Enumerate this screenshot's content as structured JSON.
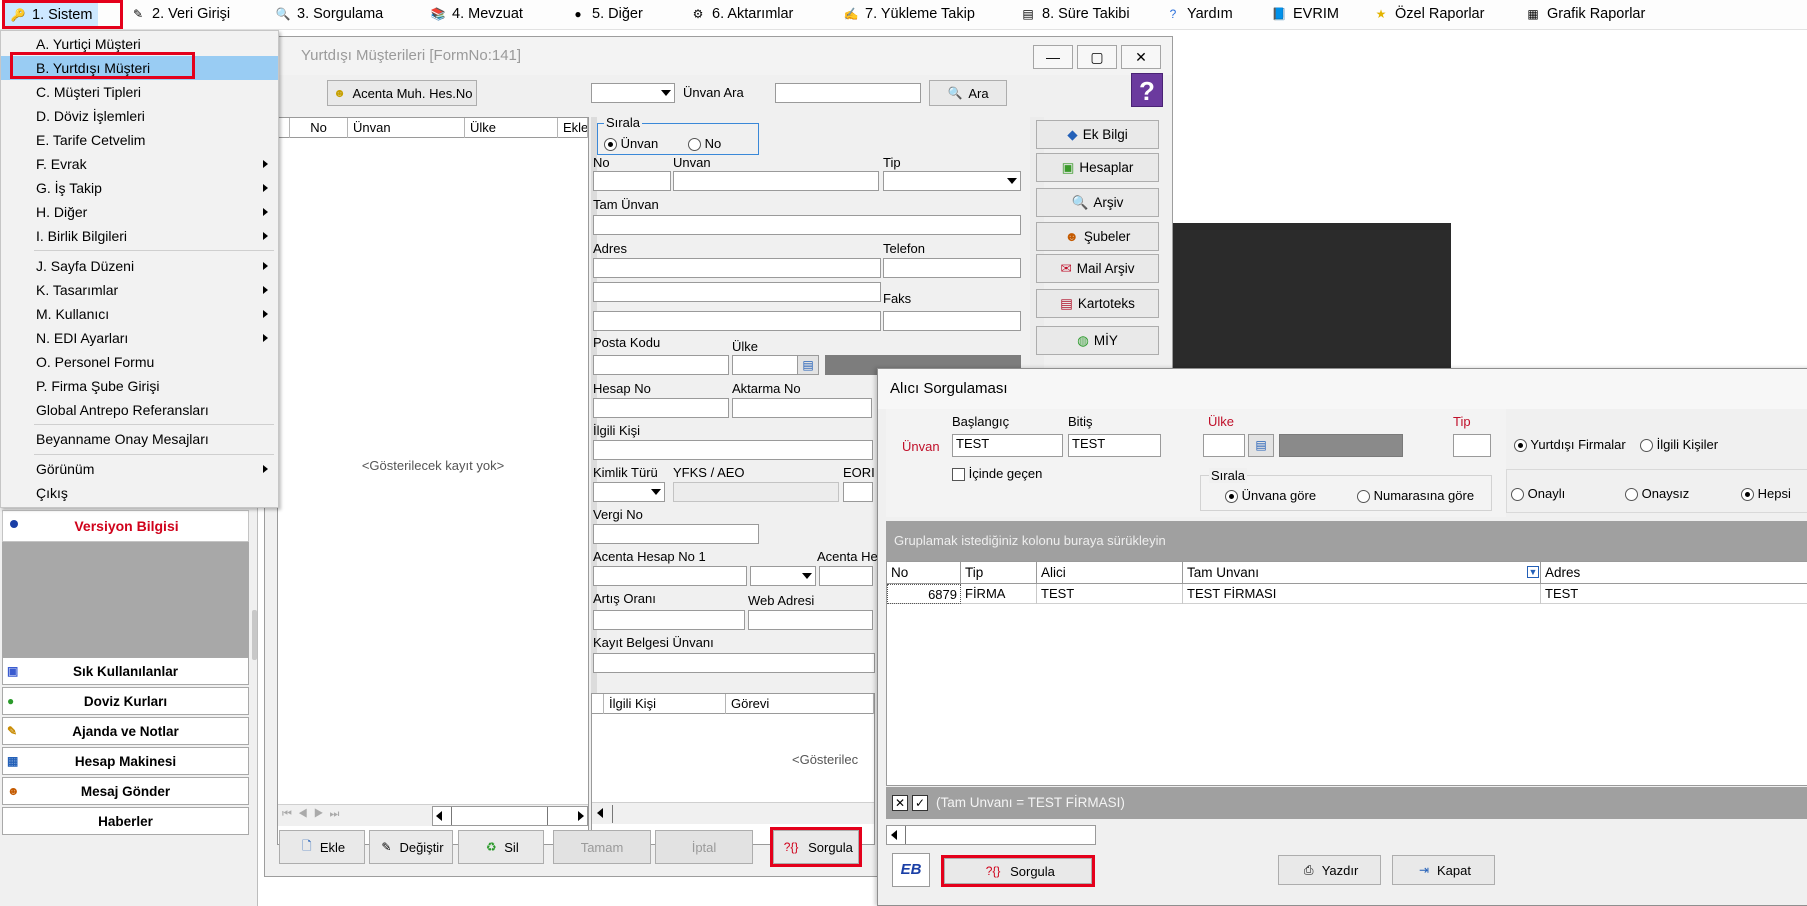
{
  "menubar": {
    "items": [
      {
        "label": "1.   Sistem",
        "icon": "system-icon"
      },
      {
        "label": "2.   Veri Girişi",
        "icon": "data-entry-icon"
      },
      {
        "label": "3.   Sorgulama",
        "icon": "query-icon"
      },
      {
        "label": "4.   Mevzuat",
        "icon": "books-icon"
      },
      {
        "label": "5.   Diğer",
        "icon": "bubbles-icon"
      },
      {
        "label": "6.   Aktarımlar",
        "icon": "gears-icon"
      },
      {
        "label": "7.   Yükleme Takip",
        "icon": "pen-icon"
      },
      {
        "label": "8. Süre Takibi",
        "icon": "document-icon"
      },
      {
        "label": "Yardım",
        "icon": "help-icon"
      },
      {
        "label": "EVRIM",
        "icon": "book-icon"
      },
      {
        "label": "Özel Raporlar",
        "icon": "star-icon"
      },
      {
        "label": "Grafik Raporlar",
        "icon": "chart-icon"
      }
    ]
  },
  "dropdown": {
    "items": [
      {
        "label": "A.   Yurtiçi Müşteri",
        "submenu": false
      },
      {
        "label": "B.   Yurtdışı Müşteri",
        "submenu": false,
        "highlighted": true
      },
      {
        "label": "C.   Müşteri Tipleri",
        "submenu": false
      },
      {
        "label": "D.   Döviz İşlemleri",
        "submenu": false
      },
      {
        "label": "E.   Tarife Cetvelim",
        "submenu": false
      },
      {
        "label": "F.   Evrak",
        "submenu": true
      },
      {
        "label": "G.   İş Takip",
        "submenu": true
      },
      {
        "label": "H.   Diğer",
        "submenu": true
      },
      {
        "label": "I.   Birlik Bilgileri",
        "submenu": true
      },
      {
        "label": "J.   Sayfa Düzeni",
        "submenu": true
      },
      {
        "label": "K.   Tasarımlar",
        "submenu": true
      },
      {
        "label": "M.   Kullanıcı",
        "submenu": true
      },
      {
        "label": "N.   EDI Ayarları",
        "submenu": true
      },
      {
        "label": "O.   Personel Formu",
        "submenu": false
      },
      {
        "label": "P.   Firma Şube Girişi",
        "submenu": false
      },
      {
        "label": "Global Antrepo Referansları",
        "submenu": false
      },
      {
        "label": "Beyanname Onay Mesajları",
        "submenu": false
      },
      {
        "label": "Görünüm",
        "submenu": true
      },
      {
        "label": "Çıkış",
        "submenu": false
      }
    ]
  },
  "leftpanel": {
    "version_label": "Versiyon Bilgisi",
    "buttons": [
      {
        "label": "Sık Kullanılanlar",
        "icon": "favorites-icon"
      },
      {
        "label": "Doviz Kurları",
        "icon": "currency-icon"
      },
      {
        "label": "Ajanda ve Notlar",
        "icon": "notes-icon"
      },
      {
        "label": "Hesap Makinesi",
        "icon": "calculator-icon"
      },
      {
        "label": "Mesaj Gönder",
        "icon": "users-icon"
      },
      {
        "label": "Haberler",
        "icon": ""
      }
    ]
  },
  "form": {
    "title": "Yurtdışı Müşterileri [FormNo:141]",
    "acenta_button": "Acenta Muh. Hes.No",
    "unvan_ara_label": "Ünvan Ara",
    "ara_button": "Ara",
    "grid_columns": [
      "No",
      "Ünvan",
      "Ülke",
      "Ekle"
    ],
    "no_records": "<Gösterilecek kayıt yok>",
    "sirala_label": "Sırala",
    "sirala_unvan": "Ünvan",
    "sirala_no": "No",
    "labels": {
      "no": "No",
      "unvan": "Unvan",
      "tip": "Tip",
      "tam_unvan": "Tam Ünvan",
      "adres": "Adres",
      "telefon": "Telefon",
      "faks": "Faks",
      "posta_kodu": "Posta Kodu",
      "ulke": "Ülke",
      "hesap_no": "Hesap No",
      "aktarma_no": "Aktarma No",
      "ilgili_kisi": "İlgili Kişi",
      "kimlik_turu": "Kimlik Türü",
      "yfks": "YFKS / AEO",
      "eori": "EORI",
      "vergi_no": "Vergi No",
      "acenta_hesap_no_1": "Acenta Hesap No 1",
      "acenta_he": "Acenta He",
      "artis_orani": "Artış Oranı",
      "web_adresi": "Web Adresi",
      "kayit_belgesi": "Kayıt Belgesi Ünvanı"
    },
    "contact_columns": [
      "İlgili Kişi",
      "Görevi"
    ],
    "contact_empty": "<Gösterilec",
    "side_buttons": [
      {
        "label": "Ek Bilgi",
        "icon": "info-icon"
      },
      {
        "label": "Hesaplar",
        "icon": "accounts-icon"
      },
      {
        "label": "Arşiv",
        "icon": "archive-icon"
      },
      {
        "label": "Şubeler",
        "icon": "branches-icon"
      },
      {
        "label": "Mail Arşiv",
        "icon": "mail-icon"
      },
      {
        "label": "Kartoteks",
        "icon": "card-index-icon"
      },
      {
        "label": "MİY",
        "icon": "globe-icon"
      }
    ],
    "bottom_buttons": {
      "ekle": "Ekle",
      "degistir": "Değiştir",
      "sil": "Sil",
      "tamam": "Tamam",
      "iptal": "İptal",
      "sorgula": "Sorgula"
    }
  },
  "dialog": {
    "title": "Alıcı Sorgulaması",
    "baslangic_label": "Başlangıç",
    "bitis_label": "Bitiş",
    "unvan_label": "Ünvan",
    "baslangic_value": "TEST",
    "bitis_value": "TEST",
    "icinde_gecen": "İçinde geçen",
    "ulke_label": "Ülke",
    "tip_label": "Tip",
    "yurtdisi_firmalar": "Yurtdışı Firmalar",
    "ilgili_kisiler": "İlgili Kişiler",
    "sirala_label": "Sırala",
    "unvana_gore": "Ünvana göre",
    "numarasina_gore": "Numarasına göre",
    "onayli": "Onaylı",
    "onaysiz": "Onaysız",
    "hepsi": "Hepsi",
    "group_hint": "Gruplamak istediğiniz kolonu buraya sürükleyin",
    "grid_columns": [
      "No",
      "Tip",
      "Alici",
      "Tam Unvanı",
      "Adres"
    ],
    "rows": [
      {
        "no": "6879",
        "tip": "FİRMA",
        "alici": "TEST",
        "tam_unvan": "TEST FİRMASI",
        "adres": "TEST"
      }
    ],
    "filter_text": "(Tam Unvanı = TEST FİRMASI)",
    "sorgula": "Sorgula",
    "yazdir": "Yazdır",
    "kapat": "Kapat"
  },
  "colors": {
    "highlight": "#e4001b",
    "menu_selected": "#99ccf3",
    "grid_band": "#a0a0a0",
    "dark_block": "#2b2b2b",
    "version_red": "#d0021b"
  }
}
